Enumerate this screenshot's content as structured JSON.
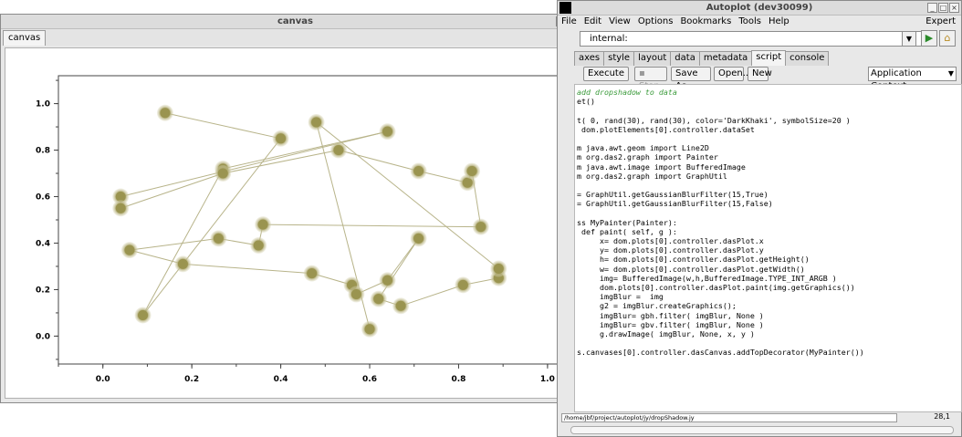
{
  "canvas_window": {
    "title": "canvas",
    "tab_label": "canvas"
  },
  "autoplot_window": {
    "title": "Autoplot (dev30099)",
    "menu": [
      "File",
      "Edit",
      "View",
      "Options",
      "Bookmarks",
      "Tools",
      "Help"
    ],
    "expert_label": "Expert",
    "uri_value": "internal:",
    "tabs": [
      "axes",
      "style",
      "layout",
      "data",
      "metadata",
      "script",
      "console"
    ],
    "active_tab": "script",
    "buttons": {
      "execute": "Execute",
      "stop": "Stop",
      "save_as": "Save As...",
      "open": "Open...",
      "new": "New"
    },
    "context_select": "Application Context",
    "script_lines": [
      "add dropshadow to data",
      "et()",
      "",
      "t( 0, rand(30), rand(30), color='DarkKhaki', symbolSize=20 )",
      " dom.plotElements[0].controller.dataSet",
      "",
      "m java.awt.geom import Line2D",
      "m org.das2.graph import Painter",
      "m java.awt.image import BufferedImage",
      "m org.das2.graph import GraphUtil",
      "",
      "= GraphUtil.getGaussianBlurFilter(15,True)",
      "= GraphUtil.getGaussianBlurFilter(15,False)",
      "",
      "ss MyPainter(Painter):",
      " def paint( self, g ):",
      "     x= dom.plots[0].controller.dasPlot.x",
      "     y= dom.plots[0].controller.dasPlot.y",
      "     h= dom.plots[0].controller.dasPlot.getHeight()",
      "     w= dom.plots[0].controller.dasPlot.getWidth()",
      "     img= BufferedImage(w,h,BufferedImage.TYPE_INT_ARGB )",
      "     dom.plots[0].controller.dasPlot.paint(img.getGraphics())",
      "     imgBlur =  img",
      "     g2 = imgBlur.createGraphics();",
      "     imgBlur= gbh.filter( imgBlur, None )",
      "     imgBlur= gbv.filter( imgBlur, None )",
      "     g.drawImage( imgBlur, None, x, y )",
      "",
      "s.canvases[0].controller.dasCanvas.addTopDecorator(MyPainter())"
    ],
    "status_path": "/home/jbf/project/autoplot/jy/dropShadow.jy",
    "cursor_position": "28,1"
  },
  "chart_data": {
    "type": "scatter",
    "x_ticks": [
      "0.0",
      "0.2",
      "0.4",
      "0.6",
      "0.8",
      "1.0"
    ],
    "y_ticks": [
      "0.0",
      "0.2",
      "0.4",
      "0.6",
      "0.8",
      "1.0"
    ],
    "xlim": [
      -0.1,
      1.07
    ],
    "ylim": [
      -0.12,
      1.12
    ],
    "color": "#9a9450",
    "line_color": "#b8b48a",
    "points": [
      [
        0.14,
        0.96
      ],
      [
        0.4,
        0.85
      ],
      [
        0.09,
        0.09
      ],
      [
        0.27,
        0.72
      ],
      [
        0.64,
        0.88
      ],
      [
        0.04,
        0.6
      ],
      [
        0.04,
        0.55
      ],
      [
        0.27,
        0.7
      ],
      [
        0.53,
        0.8
      ],
      [
        0.71,
        0.71
      ],
      [
        0.82,
        0.66
      ],
      [
        0.83,
        0.71
      ],
      [
        0.85,
        0.47
      ],
      [
        0.36,
        0.48
      ],
      [
        0.35,
        0.39
      ],
      [
        0.26,
        0.42
      ],
      [
        0.06,
        0.37
      ],
      [
        0.18,
        0.31
      ],
      [
        0.47,
        0.27
      ],
      [
        0.56,
        0.22
      ],
      [
        0.57,
        0.18
      ],
      [
        0.64,
        0.24
      ],
      [
        0.71,
        0.42
      ],
      [
        0.62,
        0.16
      ],
      [
        0.67,
        0.13
      ],
      [
        0.81,
        0.22
      ],
      [
        0.89,
        0.25
      ],
      [
        0.89,
        0.29
      ],
      [
        0.48,
        0.92
      ],
      [
        0.6,
        0.03
      ]
    ]
  }
}
